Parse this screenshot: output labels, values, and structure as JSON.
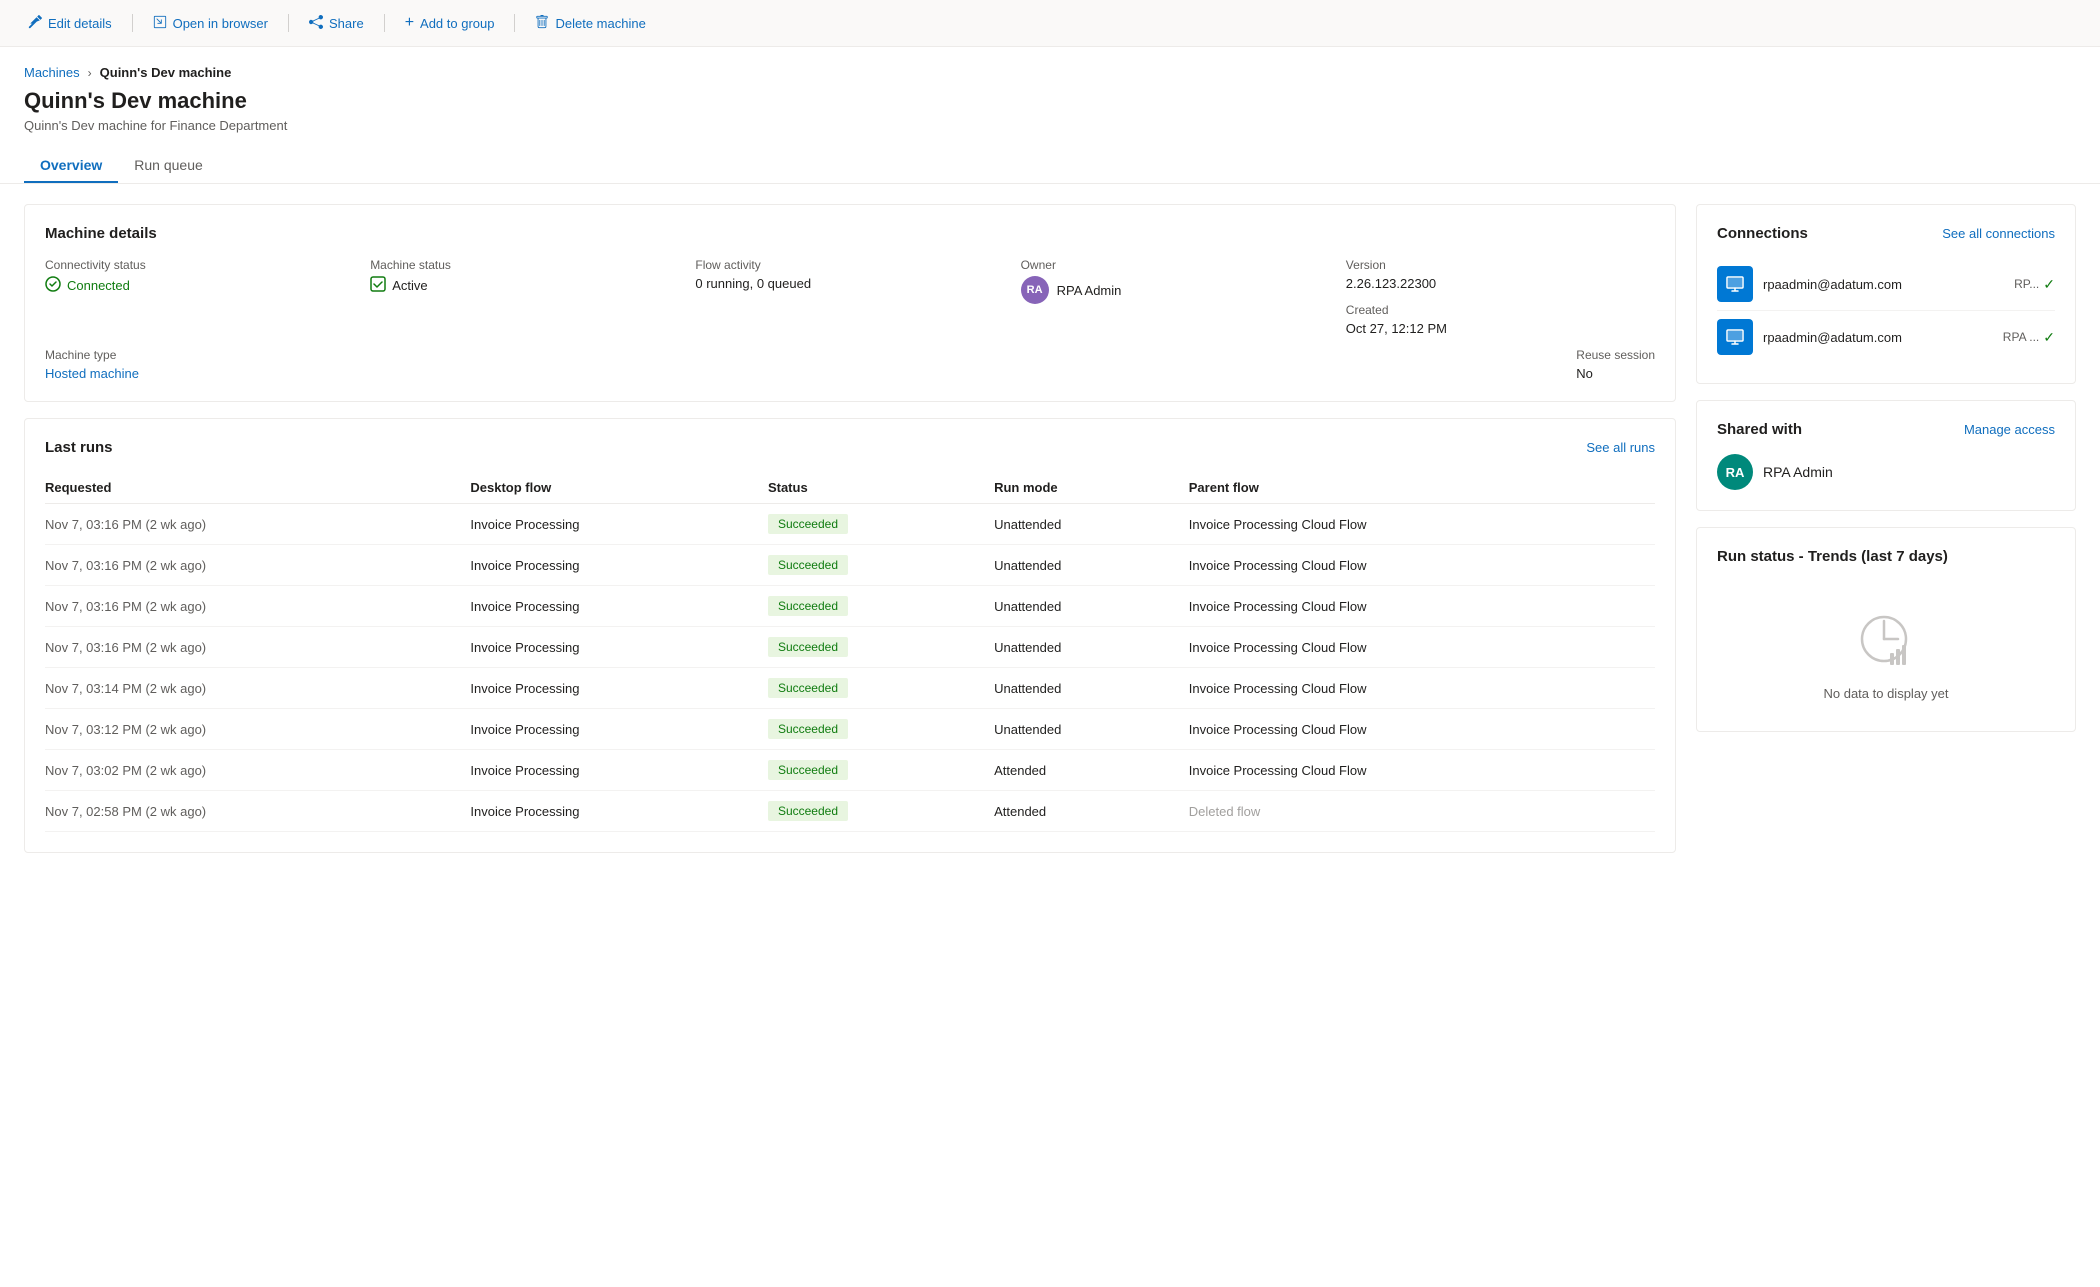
{
  "toolbar": {
    "edit_label": "Edit details",
    "open_label": "Open in browser",
    "share_label": "Share",
    "add_group_label": "Add to group",
    "delete_label": "Delete machine"
  },
  "breadcrumb": {
    "parent": "Machines",
    "current": "Quinn's Dev machine"
  },
  "page": {
    "title": "Quinn's Dev machine",
    "subtitle": "Quinn's Dev machine for Finance Department"
  },
  "tabs": [
    {
      "label": "Overview",
      "active": true
    },
    {
      "label": "Run queue",
      "active": false
    }
  ],
  "machine_details": {
    "title": "Machine details",
    "connectivity_label": "Connectivity status",
    "connectivity_value": "Connected",
    "machine_status_label": "Machine status",
    "machine_status_value": "Active",
    "flow_activity_label": "Flow activity",
    "flow_activity_value": "0 running, 0 queued",
    "owner_label": "Owner",
    "owner_value": "RPA Admin",
    "version_label": "Version",
    "version_value": "2.26.123.22300",
    "created_label": "Created",
    "created_value": "Oct 27, 12:12 PM",
    "machine_type_label": "Machine type",
    "machine_type_value": "Hosted machine",
    "reuse_session_label": "Reuse session",
    "reuse_session_value": "No"
  },
  "last_runs": {
    "title": "Last runs",
    "see_all_label": "See all runs",
    "columns": [
      "Requested",
      "Desktop flow",
      "Status",
      "Run mode",
      "Parent flow"
    ],
    "rows": [
      {
        "requested": "Nov 7, 03:16 PM (2 wk ago)",
        "desktop_flow": "Invoice Processing",
        "status": "Succeeded",
        "run_mode": "Unattended",
        "parent_flow": "Invoice Processing Cloud Flow"
      },
      {
        "requested": "Nov 7, 03:16 PM (2 wk ago)",
        "desktop_flow": "Invoice Processing",
        "status": "Succeeded",
        "run_mode": "Unattended",
        "parent_flow": "Invoice Processing Cloud Flow"
      },
      {
        "requested": "Nov 7, 03:16 PM (2 wk ago)",
        "desktop_flow": "Invoice Processing",
        "status": "Succeeded",
        "run_mode": "Unattended",
        "parent_flow": "Invoice Processing Cloud Flow"
      },
      {
        "requested": "Nov 7, 03:16 PM (2 wk ago)",
        "desktop_flow": "Invoice Processing",
        "status": "Succeeded",
        "run_mode": "Unattended",
        "parent_flow": "Invoice Processing Cloud Flow"
      },
      {
        "requested": "Nov 7, 03:14 PM (2 wk ago)",
        "desktop_flow": "Invoice Processing",
        "status": "Succeeded",
        "run_mode": "Unattended",
        "parent_flow": "Invoice Processing Cloud Flow"
      },
      {
        "requested": "Nov 7, 03:12 PM (2 wk ago)",
        "desktop_flow": "Invoice Processing",
        "status": "Succeeded",
        "run_mode": "Unattended",
        "parent_flow": "Invoice Processing Cloud Flow"
      },
      {
        "requested": "Nov 7, 03:02 PM (2 wk ago)",
        "desktop_flow": "Invoice Processing",
        "status": "Succeeded",
        "run_mode": "Attended",
        "parent_flow": "Invoice Processing Cloud Flow"
      },
      {
        "requested": "Nov 7, 02:58 PM (2 wk ago)",
        "desktop_flow": "Invoice Processing",
        "status": "Succeeded",
        "run_mode": "Attended",
        "parent_flow": "Deleted flow"
      }
    ]
  },
  "connections": {
    "title": "Connections",
    "see_all_label": "See all connections",
    "items": [
      {
        "email": "rpaadmin@adatum.com",
        "rp_label": "RP...",
        "status": "connected"
      },
      {
        "email": "rpaadmin@adatum.com",
        "rp_label": "RPA ...",
        "status": "connected"
      }
    ]
  },
  "shared_with": {
    "title": "Shared with",
    "manage_label": "Manage access",
    "users": [
      {
        "initials": "RA",
        "name": "RPA Admin"
      }
    ]
  },
  "trends": {
    "title": "Run status - Trends (last 7 days)",
    "no_data_text": "No data to display yet"
  }
}
